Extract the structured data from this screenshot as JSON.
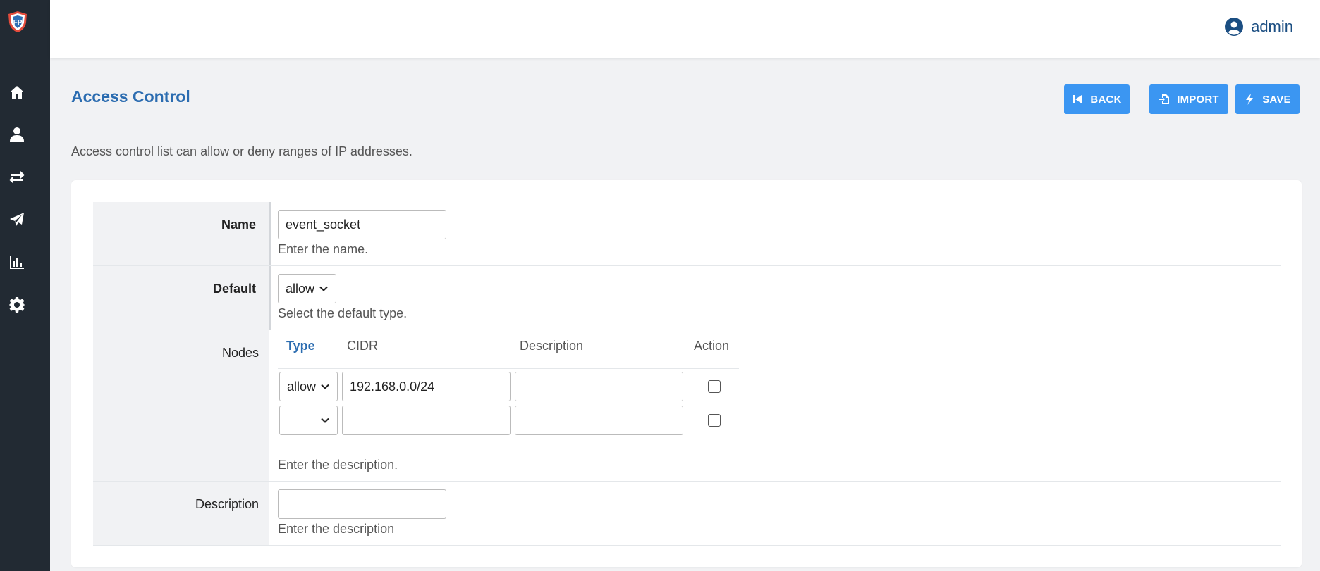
{
  "user": {
    "name": "admin",
    "icon": "user-circle-icon"
  },
  "sidebar": {
    "items": [
      {
        "name": "home",
        "icon": "home-icon"
      },
      {
        "name": "user",
        "icon": "user-icon"
      },
      {
        "name": "transfer",
        "icon": "arrows-exchange-icon"
      },
      {
        "name": "send",
        "icon": "paper-plane-icon"
      },
      {
        "name": "reports",
        "icon": "chart-bar-icon"
      },
      {
        "name": "settings",
        "icon": "gear-icon"
      }
    ]
  },
  "page": {
    "title": "Access Control",
    "description": "Access control list can allow or deny ranges of IP addresses."
  },
  "toolbar": {
    "back_label": "BACK",
    "import_label": "IMPORT",
    "save_label": "SAVE"
  },
  "form": {
    "name": {
      "label": "Name",
      "value": "event_socket",
      "help": "Enter the name."
    },
    "default": {
      "label": "Default",
      "value": "allow",
      "help": "Select the default type."
    },
    "nodes": {
      "label": "Nodes",
      "columns": {
        "type": "Type",
        "cidr": "CIDR",
        "description": "Description",
        "action": "Action"
      },
      "rows": [
        {
          "type": "allow",
          "cidr": "192.168.0.0/24",
          "description": ""
        },
        {
          "type": "",
          "cidr": "",
          "description": ""
        }
      ],
      "help": "Enter the description."
    },
    "description": {
      "label": "Description",
      "value": "",
      "help": "Enter the description"
    }
  },
  "colors": {
    "sidebar_bg": "#222a33",
    "accent": "#3b96f2",
    "title": "#2b6cb0"
  }
}
